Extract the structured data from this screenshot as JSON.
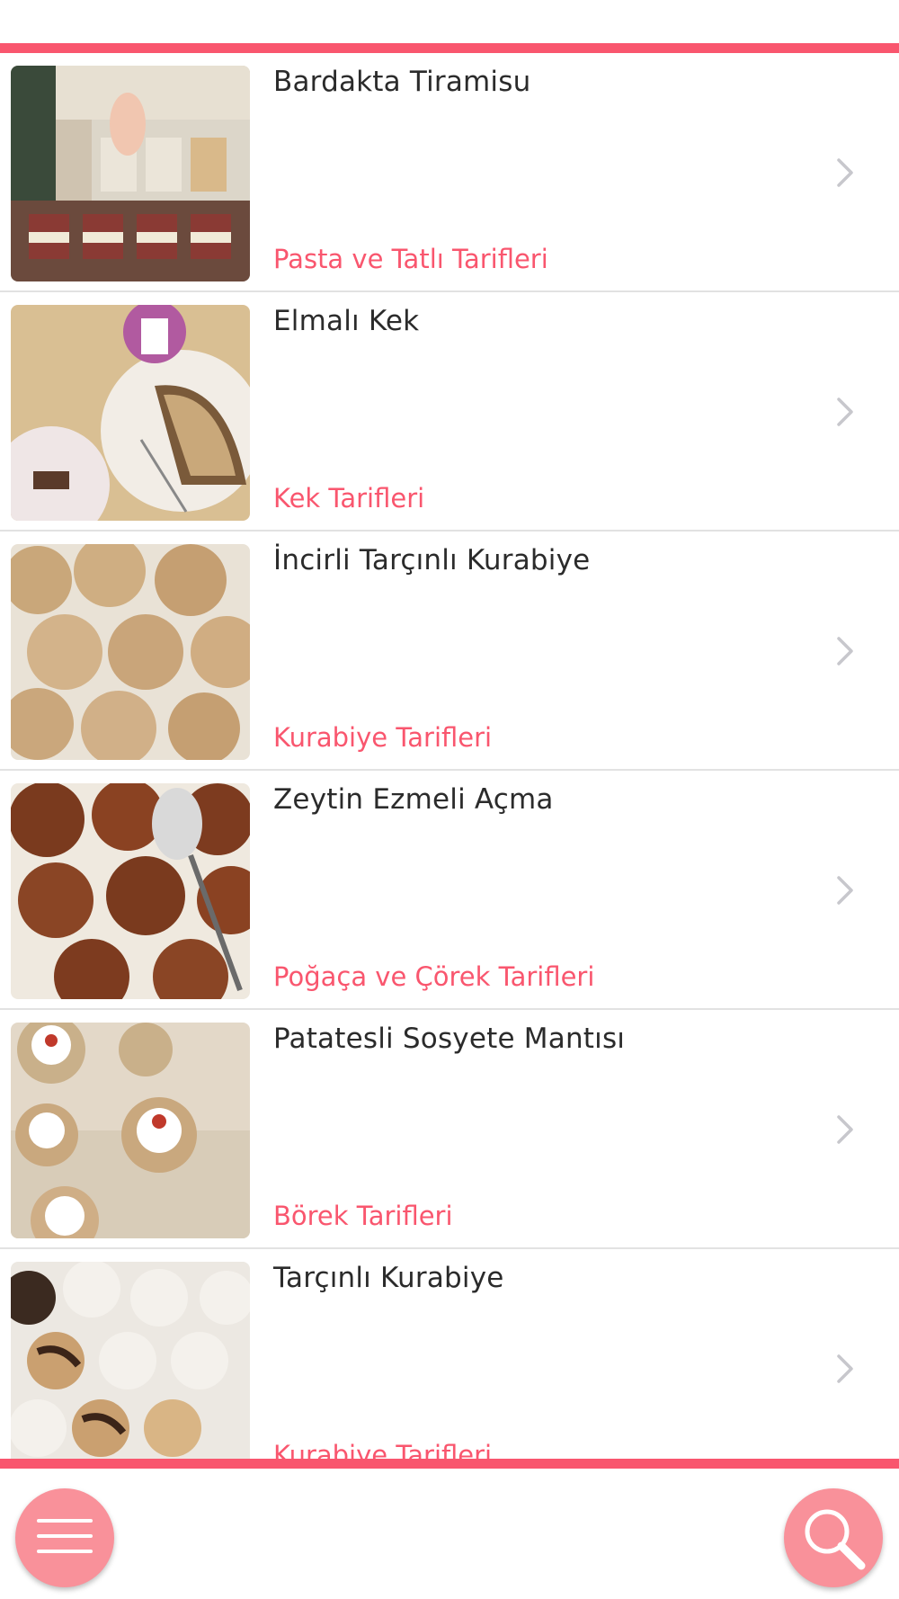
{
  "colors": {
    "accent": "#f9566e",
    "fab": "#f9919a",
    "divider": "#e2e2e2",
    "title": "#2b2b2b",
    "chevron": "#c7c7cc"
  },
  "recipes": [
    {
      "title": "Bardakta Tiramisu",
      "category": "Pasta ve Tatlı Tarifleri"
    },
    {
      "title": "Elmalı Kek",
      "category": "Kek Tarifleri"
    },
    {
      "title": "İncirli Tarçınlı Kurabiye",
      "category": "Kurabiye Tarifleri"
    },
    {
      "title": "Zeytin Ezmeli Açma",
      "category": "Poğaça ve Çörek Tarifleri"
    },
    {
      "title": "Patatesli Sosyete Mantısı",
      "category": "Börek Tarifleri"
    },
    {
      "title": "Tarçınlı Kurabiye",
      "category": "Kurabiye Tarifleri"
    }
  ],
  "icons": {
    "row_chevron": "chevron-right-icon",
    "menu": "hamburger-menu-icon",
    "search": "search-icon"
  }
}
